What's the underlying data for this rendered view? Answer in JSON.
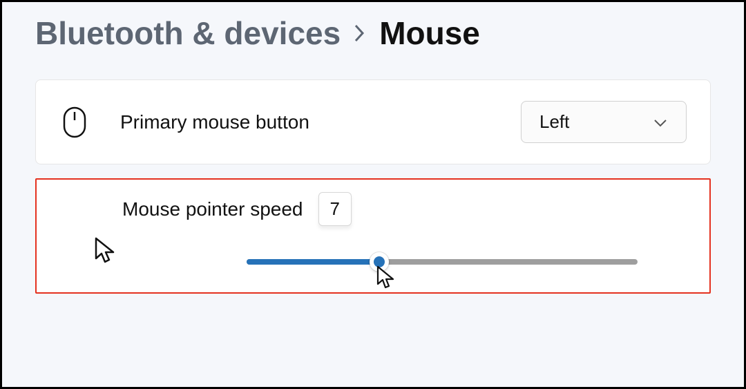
{
  "breadcrumb": {
    "parent": "Bluetooth & devices",
    "current": "Mouse"
  },
  "primary_button": {
    "label": "Primary mouse button",
    "selected": "Left"
  },
  "pointer_speed": {
    "label": "Mouse pointer speed",
    "value": "7",
    "min": 1,
    "max": 20,
    "percent": 34
  },
  "colors": {
    "accent": "#2672b8",
    "highlight_border": "#e4311f"
  }
}
